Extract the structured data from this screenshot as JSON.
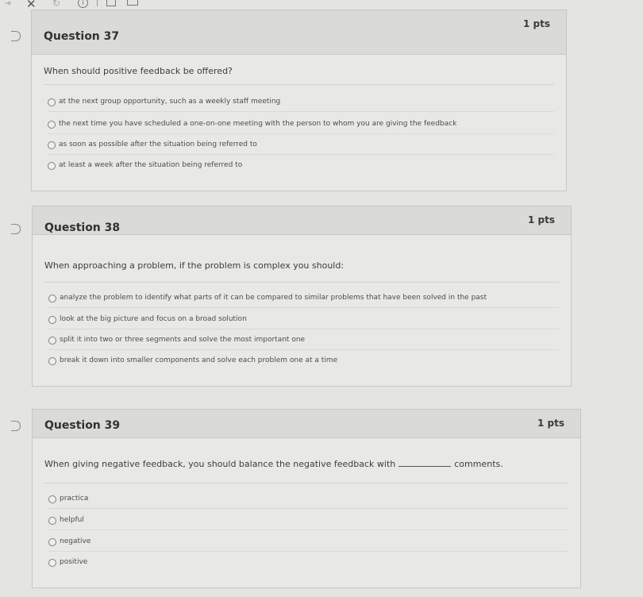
{
  "toolbar": {
    "arrow_icon": "back-arrow-icon",
    "close_icon": "close-icon",
    "close_glyph": "✕",
    "refresh_icon": "refresh-icon",
    "info_icon": "info-icon",
    "info_glyph": "i"
  },
  "questions": [
    {
      "title": "Question 37",
      "points": "1 pts",
      "text": "When should positive feedback be offered?",
      "answers": [
        "at the next group opportunity, such as a weekly staff meeting",
        "the next time you have scheduled a one-on-one meeting with the person to whom you are giving the feedback",
        "as soon as possible after the situation being referred to",
        "at least a week after the situation being referred to"
      ]
    },
    {
      "title": "Question 38",
      "points": "1 pts",
      "text": "When approaching a problem, if the problem is complex you should:",
      "answers": [
        "analyze the problem to identify what parts of it can be compared to similar problems that have been solved in the past",
        "look at the big picture and focus on a broad solution",
        "split it into two or three segments and solve the most important one",
        "break it down into smaller components and solve each problem one at a time"
      ]
    },
    {
      "title": "Question 39",
      "points": "1 pts",
      "text_before": "When giving negative feedback, you should balance the negative feedback with",
      "text_after": "comments.",
      "answers": [
        "practica",
        "helpful",
        "negative",
        "positive"
      ]
    }
  ]
}
